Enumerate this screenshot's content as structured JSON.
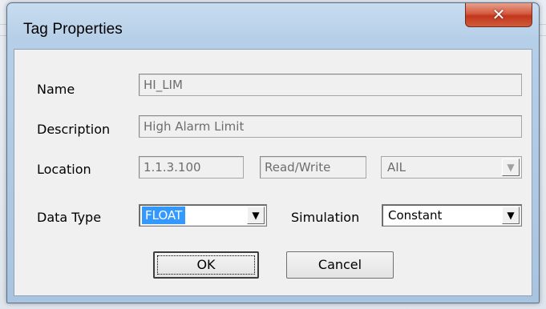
{
  "window": {
    "title": "Tag Properties",
    "close_glyph": "✕"
  },
  "form": {
    "name": {
      "label": "Name",
      "value": "HI_LIM"
    },
    "description": {
      "label": "Description",
      "value": "High Alarm Limit"
    },
    "location": {
      "label": "Location",
      "value": "1.1.3.100",
      "access": "Read/Write",
      "module": "AIL"
    },
    "data_type": {
      "label": "Data Type",
      "value": "FLOAT"
    },
    "simulation": {
      "label": "Simulation",
      "value": "Constant"
    }
  },
  "buttons": {
    "ok": "OK",
    "cancel": "Cancel"
  },
  "icons": {
    "dropdown": "chevron-down-icon",
    "close": "close-icon"
  }
}
